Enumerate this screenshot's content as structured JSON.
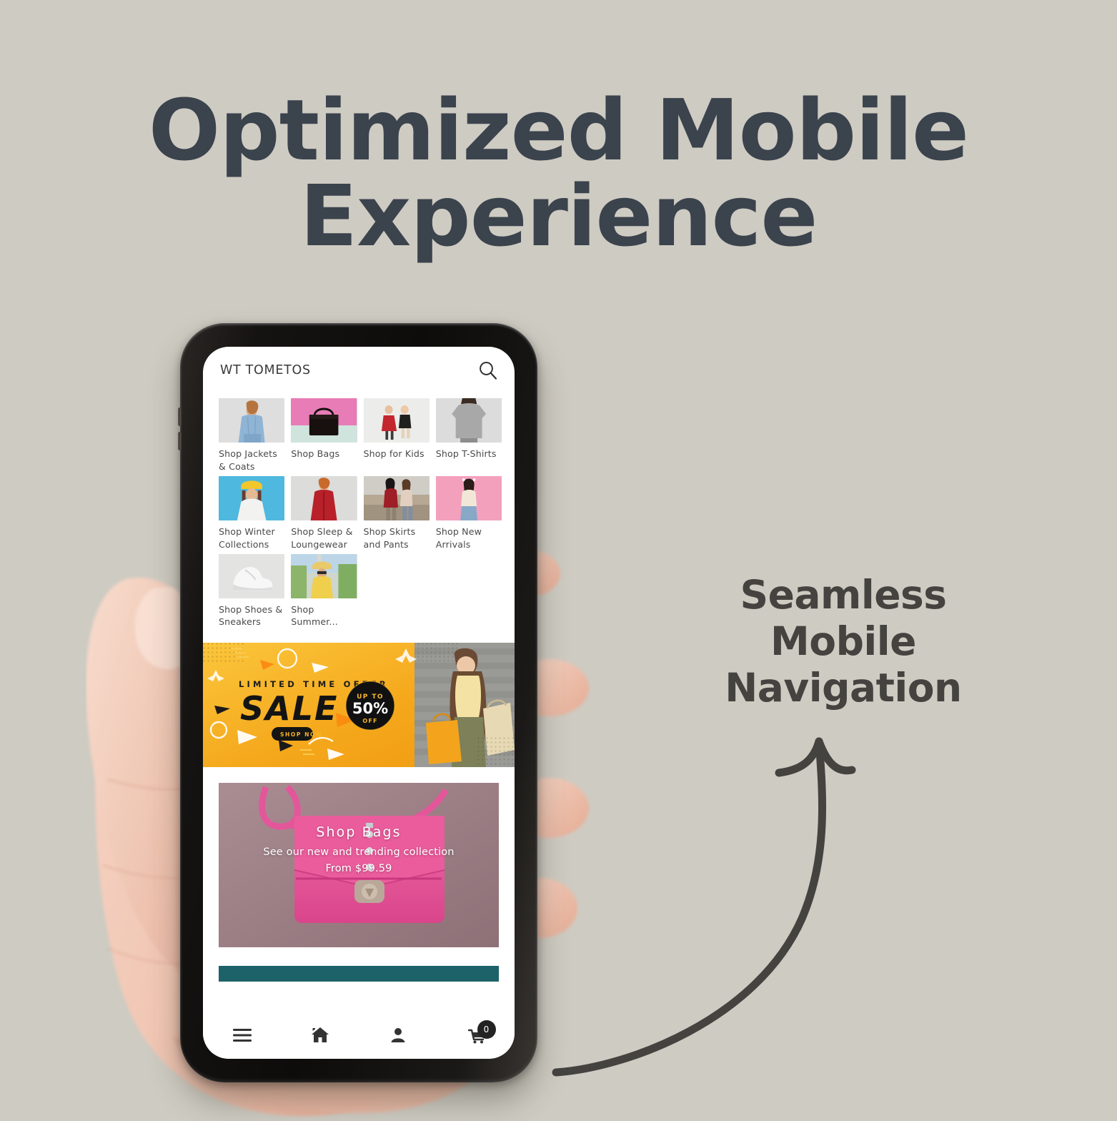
{
  "headline": {
    "line1": "Optimized Mobile",
    "line2": "Experience"
  },
  "side_caption": {
    "line1": "Seamless Mobile",
    "line2": "Navigation"
  },
  "colors": {
    "background": "#cecbc2",
    "headline_text": "#3b434d",
    "caption_text": "#44433f",
    "arrow": "#44433f",
    "phone_frame": "#151312",
    "teal_strip": "#1d6169",
    "sale_yellow": "#f5a623",
    "promo_pink": "#d95d9a"
  },
  "phone": {
    "app": {
      "header": {
        "brand": "WT TOMETOS",
        "search_icon": "search-icon"
      },
      "categories": [
        {
          "label": "Shop Jackets & Coats",
          "thumb": "woman-denim-jacket"
        },
        {
          "label": "Shop Bags",
          "thumb": "black-handbag-pink-bg"
        },
        {
          "label": "Shop for Kids",
          "thumb": "two-children"
        },
        {
          "label": "Shop T-Shirts",
          "thumb": "man-grey-tshirt"
        },
        {
          "label": "Shop Winter Collections",
          "thumb": "woman-yellow-beanie-blue-bg"
        },
        {
          "label": "Shop Sleep & Loungewear",
          "thumb": "woman-red-robe"
        },
        {
          "label": "Shop Skirts and Pants",
          "thumb": "two-women-street"
        },
        {
          "label": "Shop New Arrivals",
          "thumb": "woman-pink-bg"
        },
        {
          "label": "Shop Shoes & Sneakers",
          "thumb": "white-sneaker"
        },
        {
          "label": "Shop Summer...",
          "thumb": "woman-yellow-dress-hat"
        }
      ],
      "sale_banner": {
        "eyebrow": "LIMITED TIME OFFER",
        "title": "SALE",
        "cta": "SHOP NOW",
        "badge_top": "UP TO",
        "badge_value": "50%",
        "badge_bottom": "OFF"
      },
      "promo_card": {
        "title": "Shop Bags",
        "subtitle": "See our new and trending collection",
        "price": "From $99.59"
      },
      "bottom_nav": [
        {
          "icon": "hamburger-menu-icon",
          "label": "Menu"
        },
        {
          "icon": "home-icon",
          "label": "Home"
        },
        {
          "icon": "person-icon",
          "label": "Account"
        },
        {
          "icon": "cart-icon",
          "label": "Cart",
          "badge": "0"
        }
      ]
    }
  }
}
